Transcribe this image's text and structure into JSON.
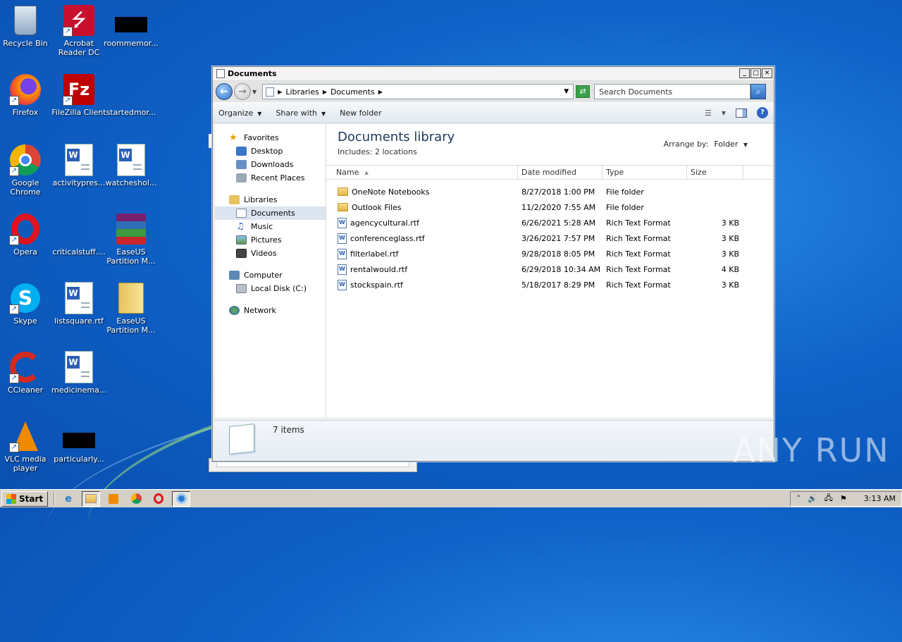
{
  "desktop": {
    "icons": [
      {
        "label": "Recycle Bin",
        "icon": "recycle-bin-icon"
      },
      {
        "label": "Acrobat Reader DC",
        "icon": "acrobat-icon"
      },
      {
        "label": "roommemor...",
        "icon": "blank-file-icon"
      },
      {
        "label": "Firefox",
        "icon": "firefox-icon"
      },
      {
        "label": "FileZilla Client",
        "icon": "filezilla-icon"
      },
      {
        "label": "startedmor...",
        "icon": "blank-file-icon"
      },
      {
        "label": "Google Chrome",
        "icon": "chrome-icon"
      },
      {
        "label": "activitypres...",
        "icon": "word-doc-icon"
      },
      {
        "label": "watcheshol...",
        "icon": "word-doc-icon"
      },
      {
        "label": "Opera",
        "icon": "opera-icon"
      },
      {
        "label": "criticalstuff....",
        "icon": "blank-file-icon"
      },
      {
        "label": "EaseUS Partition M...",
        "icon": "winrar-icon"
      },
      {
        "label": "Skype",
        "icon": "skype-icon"
      },
      {
        "label": "listsquare.rtf",
        "icon": "word-doc-icon"
      },
      {
        "label": "EaseUS Partition M...",
        "icon": "folder-icon"
      },
      {
        "label": "CCleaner",
        "icon": "ccleaner-icon"
      },
      {
        "label": "medicinema...",
        "icon": "word-doc-icon"
      },
      {
        "label": "VLC media player",
        "icon": "vlc-icon"
      },
      {
        "label": "particularly...",
        "icon": "blank-file-icon"
      }
    ]
  },
  "window": {
    "title": "Documents",
    "address": {
      "crumbs": [
        "Libraries",
        "Documents"
      ]
    },
    "search_placeholder": "Search Documents",
    "toolbar": {
      "organize": "Organize",
      "share": "Share with",
      "newfolder": "New folder"
    },
    "nav": {
      "favorites": "Favorites",
      "desktop": "Desktop",
      "downloads": "Downloads",
      "recent": "Recent Places",
      "libraries": "Libraries",
      "documents": "Documents",
      "music": "Music",
      "pictures": "Pictures",
      "videos": "Videos",
      "computer": "Computer",
      "localdisk": "Local Disk (C:)",
      "network": "Network"
    },
    "library": {
      "title": "Documents library",
      "includes": "Includes:  2 locations",
      "arrange_label": "Arrange by:",
      "arrange_value": "Folder"
    },
    "columns": {
      "name": "Name",
      "date": "Date modified",
      "type": "Type",
      "size": "Size"
    },
    "files": [
      {
        "name": "OneNote Notebooks",
        "date": "8/27/2018 1:00 PM",
        "type": "File folder",
        "size": "",
        "kind": "folder"
      },
      {
        "name": "Outlook Files",
        "date": "11/2/2020 7:55 AM",
        "type": "File folder",
        "size": "",
        "kind": "folder"
      },
      {
        "name": "agencycultural.rtf",
        "date": "6/26/2021 5:28 AM",
        "type": "Rich Text Format",
        "size": "3 KB",
        "kind": "rtf"
      },
      {
        "name": "conferenceglass.rtf",
        "date": "3/26/2021 7:57 PM",
        "type": "Rich Text Format",
        "size": "3 KB",
        "kind": "rtf"
      },
      {
        "name": "filterlabel.rtf",
        "date": "9/28/2018 8:05 PM",
        "type": "Rich Text Format",
        "size": "3 KB",
        "kind": "rtf"
      },
      {
        "name": "rentalwould.rtf",
        "date": "6/29/2018 10:34 AM",
        "type": "Rich Text Format",
        "size": "4 KB",
        "kind": "rtf"
      },
      {
        "name": "stockspain.rtf",
        "date": "5/18/2017 8:29 PM",
        "type": "Rich Text Format",
        "size": "3 KB",
        "kind": "rtf"
      }
    ],
    "status": "7 items"
  },
  "watermark": "ANY RUN",
  "taskbar": {
    "start": "Start",
    "clock": "3:13 AM"
  }
}
